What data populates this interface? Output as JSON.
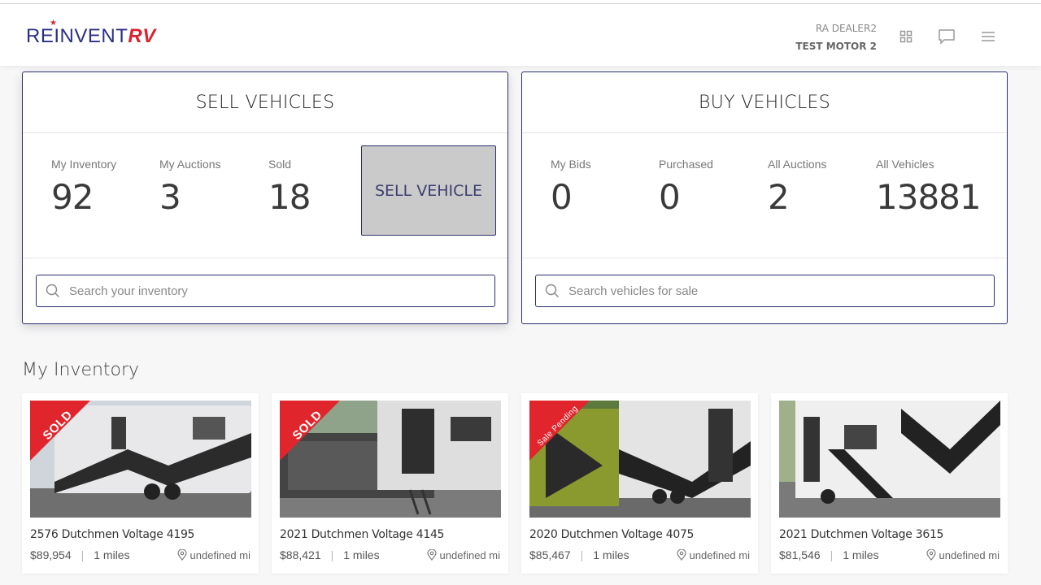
{
  "header": {
    "logo_main": "REINVENT",
    "logo_accent": "RV",
    "dealer_line1": "RA DEALER2",
    "dealer_line2": "TEST MOTOR 2"
  },
  "sell": {
    "title": "SELL VEHICLES",
    "stats": [
      {
        "label": "My Inventory",
        "value": "92"
      },
      {
        "label": "My Auctions",
        "value": "3"
      },
      {
        "label": "Sold",
        "value": "18"
      }
    ],
    "button": "SELL VEHICLE",
    "search_placeholder": "Search your inventory"
  },
  "buy": {
    "title": "BUY VEHICLES",
    "stats": [
      {
        "label": "My Bids",
        "value": "0"
      },
      {
        "label": "Purchased",
        "value": "0"
      },
      {
        "label": "All Auctions",
        "value": "2"
      },
      {
        "label": "All Vehicles",
        "value": "13881"
      }
    ],
    "search_placeholder": "Search vehicles for sale"
  },
  "inventory": {
    "title": "My Inventory",
    "cards": [
      {
        "title": "2576 Dutchmen Voltage 4195",
        "price": "$89,954",
        "miles": "1 miles",
        "location": "undefined mi",
        "badge": "SOLD"
      },
      {
        "title": "2021 Dutchmen Voltage 4145",
        "price": "$88,421",
        "miles": "1 miles",
        "location": "undefined mi",
        "badge": "SOLD"
      },
      {
        "title": "2020 Dutchmen Voltage 4075",
        "price": "$85,467",
        "miles": "1 miles",
        "location": "undefined mi",
        "badge": "Sale Pending"
      },
      {
        "title": "2021 Dutchmen Voltage 3615",
        "price": "$81,546",
        "miles": "1 miles",
        "location": "undefined mi",
        "badge": ""
      }
    ]
  }
}
